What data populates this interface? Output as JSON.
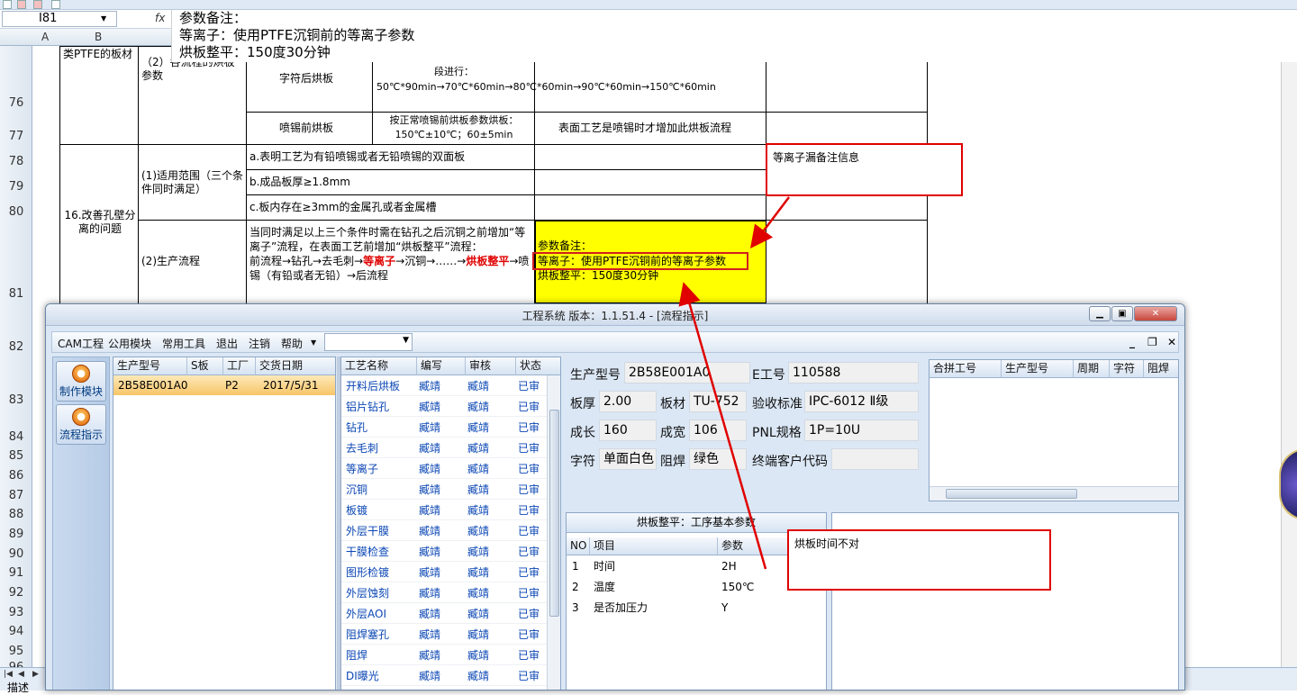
{
  "excel": {
    "name_box": "I81",
    "fx_label": "fx",
    "formula_lines": [
      "参数备注：",
      "等离子：使用PTFE沉铜前的等离子参数",
      "烘板整平：150度30分钟"
    ],
    "columns": [
      "A",
      "B"
    ],
    "rows": [
      "76",
      "77",
      "78",
      "79",
      "80",
      "81",
      "82",
      "83",
      "84",
      "85",
      "86",
      "87",
      "88",
      "89",
      "90",
      "91",
      "92",
      "93",
      "94",
      "95",
      "96"
    ],
    "cells": {
      "b_top": "类PTFE的板材",
      "c_top": "（2）各流程的烘板参数",
      "d76": "字符后烘板",
      "e76": "段进行：50℃*90min→70℃*60min→80℃*60min→90℃*60min→150℃*60min",
      "d77": "喷锡前烘板",
      "e77": "按正常喷锡前烘板参数烘板：150℃±10℃；60±5min",
      "f77": "表面工艺是喷锡时才增加此烘板流程",
      "b78": "16.改善孔壁分离的问题",
      "c78": "(1)适用范围（三个条件同时满足）",
      "d78": "a.表明工艺为有铅喷锡或者无铅喷锡的双面板",
      "d79": "b.成品板厚≥1.8mm",
      "d80": "c.板内存在≥3mm的金属孔或者金属槽",
      "c81": "(2)生产流程",
      "d81_a": "当同时满足以上三个条件时需在钻孔之后沉铜之前增加“等离子”流程，在表面工艺前增加“烘板整平”流程：",
      "d81_b": "前流程→钻孔→去毛刺→",
      "d81_red1": "等离子",
      "d81_c": "→沉铜→……→",
      "d81_red2": "烘板整平",
      "d81_d": "→喷锡（有铅或者无铅）→后流程",
      "f81_1": "参数备注：",
      "f81_2": "等离子：使用PTFE沉铜前的等离子参数",
      "f81_3": "烘板整平：150度30分钟"
    },
    "annotations": {
      "note1": "等离子漏备注信息",
      "note2": "烘板时间不对"
    },
    "sheet_tab": "描述"
  },
  "app": {
    "title": "工程系统   版本：1.1.51.4 - [流程指示]",
    "menu": [
      "CAM工程",
      "公用模块",
      "常用工具",
      "退出",
      "注销",
      "帮助"
    ],
    "nav": [
      "制作模块",
      "流程指示"
    ],
    "orders": {
      "headers": [
        "生产型号",
        "S板",
        "工厂",
        "交货日期"
      ],
      "rows": [
        [
          "2B58E001A0",
          "",
          "P2",
          "2017/5/31"
        ]
      ]
    },
    "process": {
      "headers": [
        "工艺名称",
        "编写",
        "审核",
        "状态"
      ],
      "rows": [
        [
          "开料后烘板",
          "臧靖",
          "臧靖",
          "已审"
        ],
        [
          "铝片钻孔",
          "臧靖",
          "臧靖",
          "已审"
        ],
        [
          "钻孔",
          "臧靖",
          "臧靖",
          "已审"
        ],
        [
          "去毛刺",
          "臧靖",
          "臧靖",
          "已审"
        ],
        [
          "等离子",
          "臧靖",
          "臧靖",
          "已审"
        ],
        [
          "沉铜",
          "臧靖",
          "臧靖",
          "已审"
        ],
        [
          "板镀",
          "臧靖",
          "臧靖",
          "已审"
        ],
        [
          "外层干膜",
          "臧靖",
          "臧靖",
          "已审"
        ],
        [
          "干膜检查",
          "臧靖",
          "臧靖",
          "已审"
        ],
        [
          "图形检镀",
          "臧靖",
          "臧靖",
          "已审"
        ],
        [
          "外层蚀刻",
          "臧靖",
          "臧靖",
          "已审"
        ],
        [
          "外层AOI",
          "臧靖",
          "臧靖",
          "已审"
        ],
        [
          "阻焊塞孔",
          "臧靖",
          "臧靖",
          "已审"
        ],
        [
          "阻焊",
          "臧靖",
          "臧靖",
          "已审"
        ],
        [
          "DI曝光",
          "臧靖",
          "臧靖",
          "已审"
        ]
      ]
    },
    "form": {
      "model_label": "生产型号",
      "model_value": "2B58E001A0",
      "eno_label": "E工号",
      "eno_value": "110588",
      "thick_label": "板厚",
      "thick_value": "2.00",
      "mat_label": "板材",
      "mat_value": "TU-752",
      "std_label": "验收标准",
      "std_value": "IPC-6012 Ⅱ级",
      "len_label": "成长",
      "len_value": "160",
      "wid_label": "成宽",
      "wid_value": "106",
      "pnl_label": "PNL规格",
      "pnl_value": "1P=10U",
      "char_label": "字符",
      "char_value": "单面白色",
      "mask_label": "阻焊",
      "mask_value": "绿色",
      "cust_label": "终端客户代码",
      "cust_value": ""
    },
    "merge": {
      "headers": [
        "合拼工号",
        "生产型号",
        "周期",
        "字符",
        "阻焊"
      ]
    },
    "params": {
      "title": "烘板整平：工序基本参数",
      "headers": [
        "NO",
        "项目",
        "参数"
      ],
      "rows": [
        [
          "1",
          "时间",
          "2H"
        ],
        [
          "2",
          "温度",
          "150℃"
        ],
        [
          "3",
          "是否加压力",
          "Y"
        ]
      ]
    }
  }
}
